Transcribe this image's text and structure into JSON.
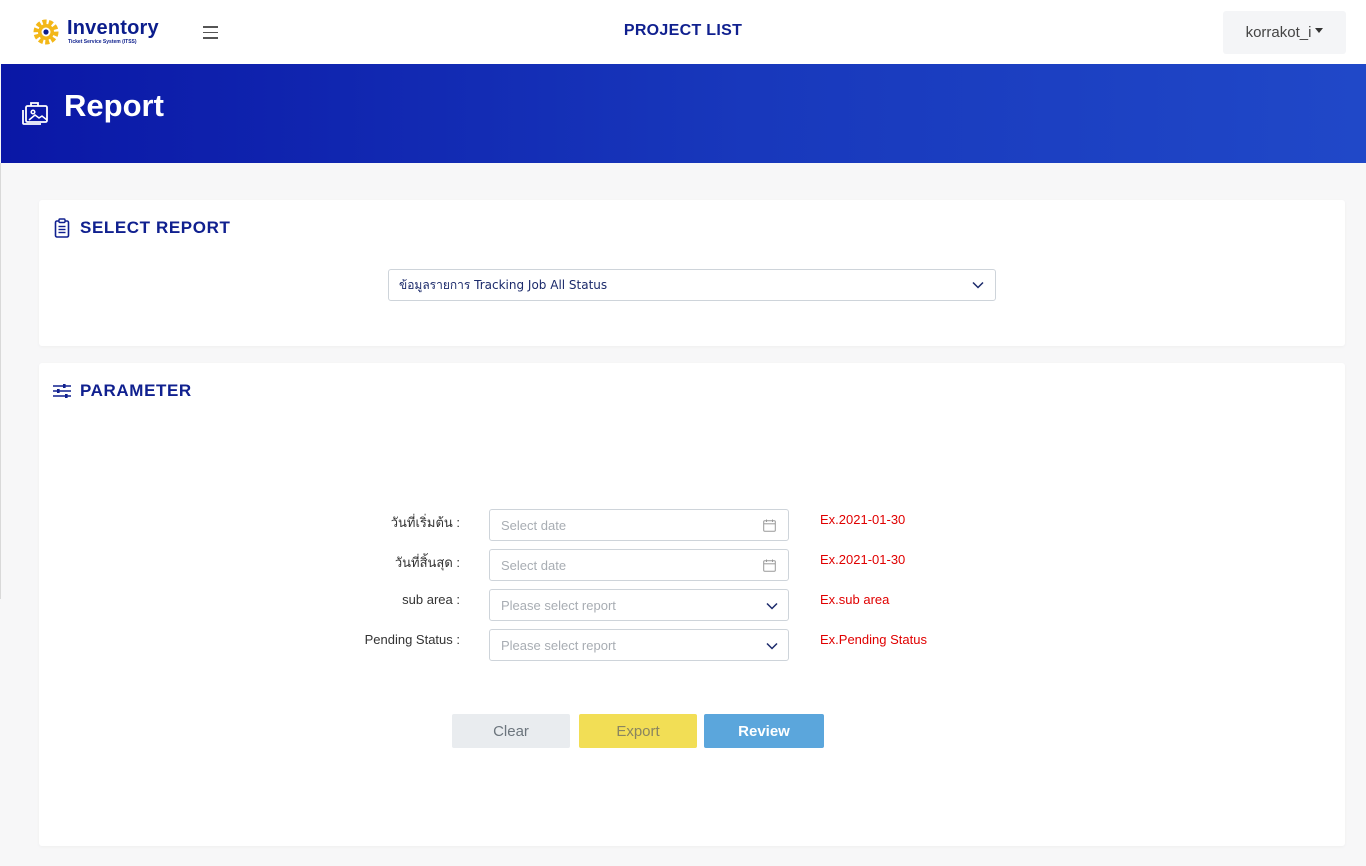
{
  "header": {
    "logo_title": "Inventory",
    "logo_subtitle": "Ticket Service System (ITSS)",
    "page_title": "PROJECT LIST",
    "user_name": "korrakot_i"
  },
  "banner": {
    "title": "Report"
  },
  "select_report": {
    "heading": "SELECT REPORT",
    "selected_value": "ข้อมูลรายการ Tracking Job All Status"
  },
  "parameter": {
    "heading": "PARAMETER",
    "fields": [
      {
        "label": "วันที่เริ่มต้น :",
        "placeholder": "Select date",
        "hint": "Ex.2021-01-30"
      },
      {
        "label": "วันที่สิ้นสุด :",
        "placeholder": "Select date",
        "hint": "Ex.2021-01-30"
      },
      {
        "label": "sub area :",
        "placeholder": "Please select report",
        "hint": "Ex.sub area"
      },
      {
        "label": "Pending Status :",
        "placeholder": "Please select report",
        "hint": "Ex.Pending Status"
      }
    ],
    "buttons": {
      "clear": "Clear",
      "export": "Export",
      "review": "Review"
    }
  },
  "colors": {
    "brand_blue": "#10208f",
    "banner_start": "#0a17a6",
    "banner_end": "#2048c8",
    "hint_red": "#e00000",
    "export_yellow": "#f2de55",
    "review_blue": "#5ba6dc"
  },
  "icons": [
    "gear-logo-icon",
    "hamburger-icon",
    "gallery-icon",
    "clipboard-icon",
    "sliders-icon",
    "chevron-down-icon",
    "calendar-icon",
    "caret-down-icon"
  ]
}
